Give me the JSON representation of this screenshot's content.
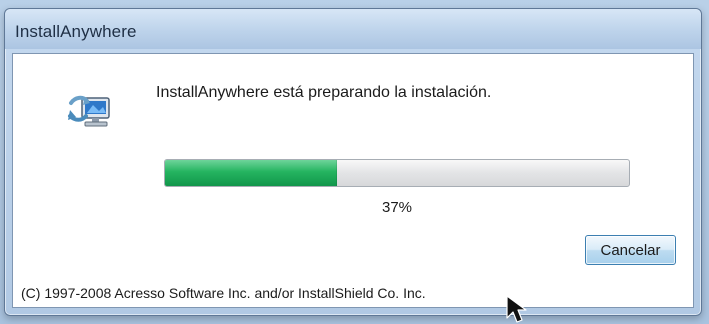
{
  "window": {
    "title": "InstallAnywhere"
  },
  "main": {
    "icon": "installer-computer-icon",
    "message": "InstallAnywhere está preparando la instalación.",
    "progress": {
      "value": 37,
      "max": 100,
      "label": "37%"
    },
    "cancel_label": "Cancelar",
    "copyright": "(C) 1997-2008 Acresso Software Inc. and/or InstallShield Co. Inc."
  },
  "colors": {
    "progress_fill": "#25b460",
    "titlebar": "#bdd3eb",
    "button_border": "#3c7fb1"
  }
}
